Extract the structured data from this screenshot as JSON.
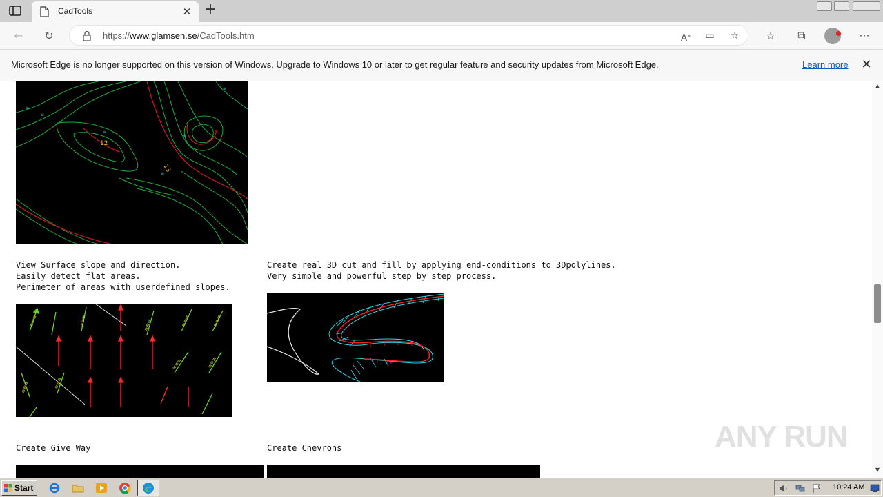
{
  "browser": {
    "tab_title": "CadTools",
    "url_prefix": "https://",
    "url_host": "www.glamsen.se",
    "url_path": "/CadTools.htm"
  },
  "infobar": {
    "message": "Microsoft Edge is no longer supported on this version of Windows. Upgrade to Windows 10 or later to get regular feature and security updates from Microsoft Edge.",
    "learn_more": "Learn more"
  },
  "page": {
    "slope_text": "View Surface slope and direction.\nEasily detect flat areas.\nPerimeter of areas with userdefined slopes.",
    "cutfill_text": "Create real 3D cut and fill by applying end-conditions to 3Dpolylines.\nVery simple and powerful step by step process.",
    "give_way_text": "Create Give Way",
    "chevrons_text": "Create Chevrons",
    "contour_labels": [
      "12",
      "13"
    ]
  },
  "taskbar": {
    "start_label": "Start",
    "clock": "10:24 AM"
  },
  "watermark": "ANY RUN",
  "icons": [
    "tab-actions-icon",
    "page-icon",
    "close-icon",
    "plus-icon",
    "back-arrow-icon",
    "refresh-icon",
    "lock-icon",
    "read-aloud-icon",
    "immersive-reader-icon",
    "add-favorite-icon",
    "favorites-icon",
    "collections-icon",
    "more-icon",
    "windows-logo-icon",
    "ie-icon",
    "folder-icon",
    "media-icon",
    "chrome-icon",
    "edge-icon",
    "volume-icon",
    "network-icon",
    "flag-icon",
    "monitor-icon"
  ],
  "colors": {
    "titlebar": "#cfcfcf",
    "link": "#0a5fb4",
    "taskbar": "#d4d0c8"
  }
}
